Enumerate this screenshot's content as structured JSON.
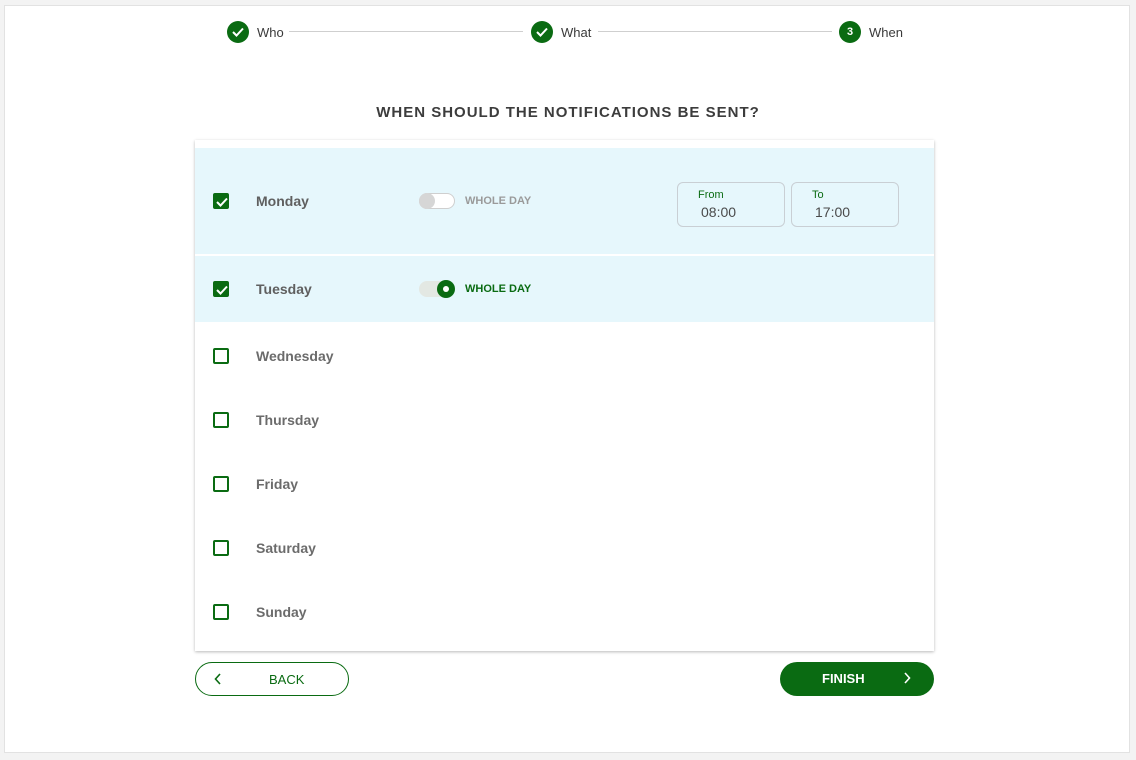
{
  "stepper": {
    "steps": [
      {
        "label": "Who",
        "state": "done",
        "icon": "check-icon"
      },
      {
        "label": "What",
        "state": "done",
        "icon": "check-icon"
      },
      {
        "label": "When",
        "state": "current",
        "number": "3"
      }
    ]
  },
  "page": {
    "title": "WHEN SHOULD THE NOTIFICATIONS BE SENT?"
  },
  "days": [
    {
      "label": "Monday",
      "checked": true,
      "whole_day_label": "WHOLE DAY",
      "whole_day": false,
      "from_label": "From",
      "from_value": "08:00",
      "to_label": "To",
      "to_value": "17:00"
    },
    {
      "label": "Tuesday",
      "checked": true,
      "whole_day_label": "WHOLE DAY",
      "whole_day": true
    },
    {
      "label": "Wednesday",
      "checked": false
    },
    {
      "label": "Thursday",
      "checked": false
    },
    {
      "label": "Friday",
      "checked": false
    },
    {
      "label": "Saturday",
      "checked": false
    },
    {
      "label": "Sunday",
      "checked": false
    }
  ],
  "actions": {
    "back_label": "BACK",
    "finish_label": "FINISH"
  },
  "colors": {
    "accent": "#0a6b12",
    "row_highlight": "#e6f7fc"
  }
}
